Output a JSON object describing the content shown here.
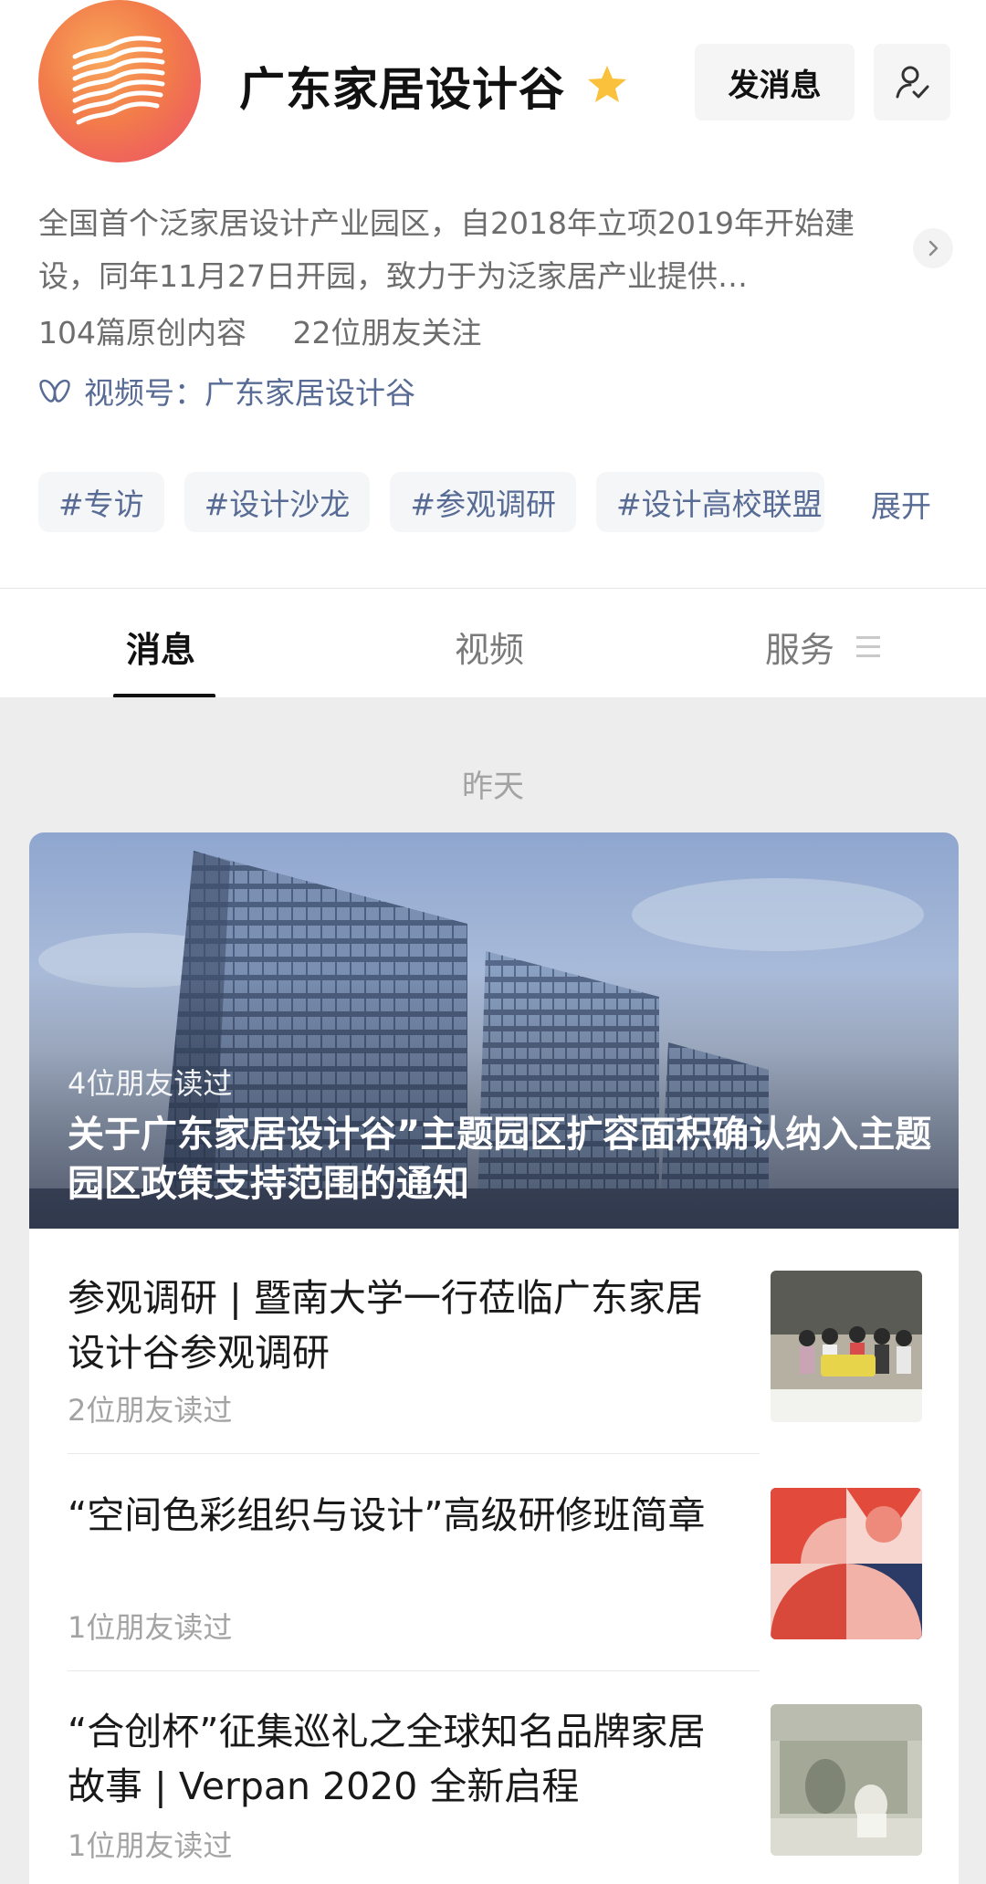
{
  "account": {
    "name": "广东家居设计谷",
    "verified_icon": "star-icon",
    "send_message_label": "发消息",
    "follow_icon": "person-check-icon",
    "description": "全国首个泛家居设计产业园区，自2018年立项2019年开始建设，同年11月27日开园，致力于为泛家居产业提供…",
    "original_count": "104篇原创内容",
    "friends_following": "22位朋友关注",
    "channel_label": "视频号：广东家居设计谷",
    "tags": [
      "#专访",
      "#设计沙龙",
      "#参观调研",
      "#设计高校联盟"
    ],
    "expand_label": "展开"
  },
  "tabs": [
    {
      "label": "消息",
      "active": true
    },
    {
      "label": "视频",
      "active": false
    },
    {
      "label": "服务",
      "active": false
    }
  ],
  "feed": {
    "date_label": "昨天",
    "hero": {
      "read_by": "4位朋友读过",
      "title": "关于广东家居设计谷”主题园区扩容面积确认纳入主题园区政策支持范围的通知"
    },
    "articles": [
      {
        "title": "参观调研 | 暨南大学一行莅临广东家居设计谷参观调研",
        "read_by": "2位朋友读过"
      },
      {
        "title": "“空间色彩组织与设计”高级研修班简章",
        "read_by": "1位朋友读过"
      },
      {
        "title": "“合创杯”征集巡礼之全球知名品牌家居故事 | Verpan 2020 全新启程",
        "read_by": "1位朋友读过"
      }
    ]
  },
  "colors": {
    "link_blue": "#576b95",
    "logo_orange": "#f27c4a",
    "logo_pink": "#ec4f6a",
    "star_yellow": "#fac13c",
    "feed_bg": "#ededed"
  }
}
